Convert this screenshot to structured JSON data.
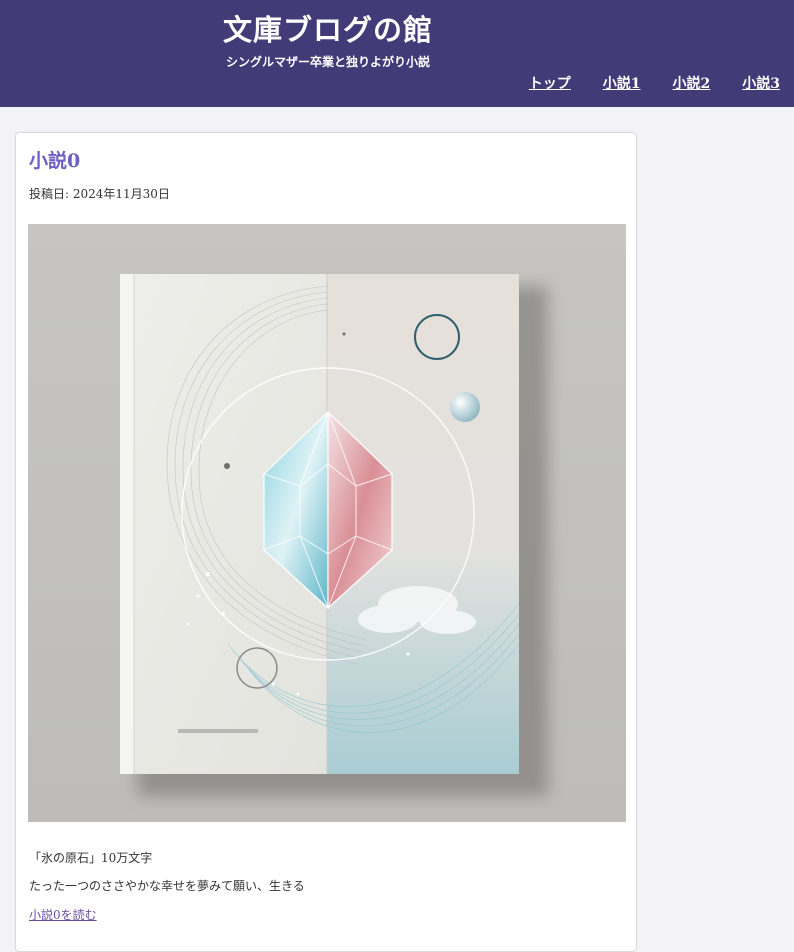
{
  "site": {
    "title": "文庫ブログの館",
    "tagline": "シングルマザー卒業と独りよがり小説"
  },
  "nav": {
    "items": [
      {
        "label": "トップ"
      },
      {
        "label": "小説1"
      },
      {
        "label": "小説2"
      },
      {
        "label": "小説3"
      }
    ]
  },
  "post": {
    "title": "小説0",
    "date": "投稿日: 2024年11月30日",
    "image_alt": "小説0 表紙",
    "excerpt_1": "「氷の原石」10万文字",
    "excerpt_2": "たった一つのささやかな幸せを夢みて願い、生きる",
    "read_link": "小説0を読む"
  },
  "colors": {
    "header_bg": "#433a78",
    "accent": "#6a5fc4",
    "page_bg": "#f3f2f7"
  }
}
